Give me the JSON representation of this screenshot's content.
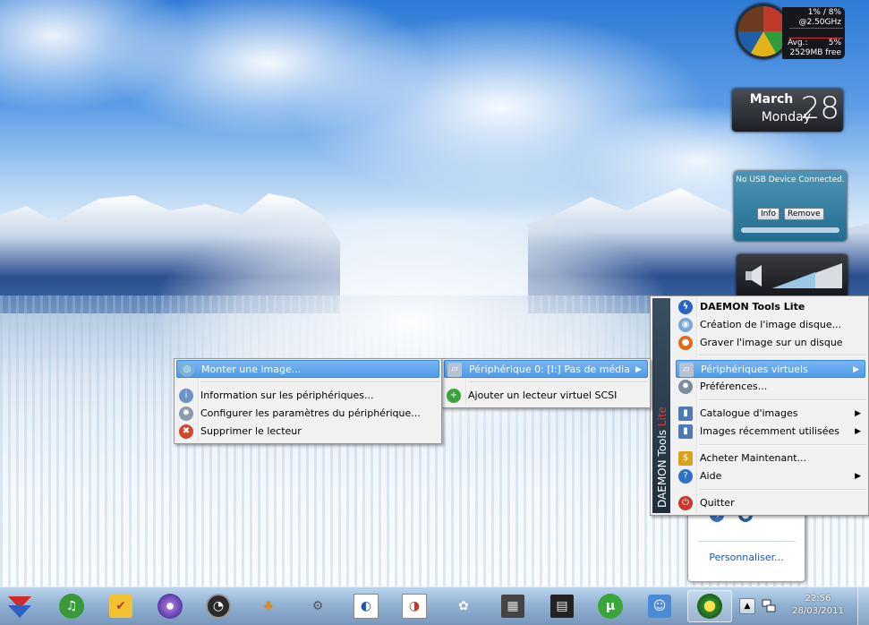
{
  "gadgets": {
    "cpu_meter": {
      "usage_line": "1% /   8%",
      "speed": "@2.50GHz",
      "avg_label": "Avg.:",
      "avg_value": "5%",
      "memory_free": "2529MB free"
    },
    "calendar": {
      "month": "March",
      "weekday": "Monday",
      "day": "28"
    },
    "usb": {
      "message": "No USB Device Connected.",
      "info_label": "Info",
      "remove_label": "Remove"
    },
    "volume": {
      "icon": "speaker-icon"
    }
  },
  "tray_popup": {
    "customize_link": "Personnaliser..."
  },
  "daemon_menu": {
    "banner_text": "DAEMON Tools",
    "banner_accent": "Lite",
    "items": [
      {
        "label": "DAEMON Tools Lite",
        "icon": "daemon-lightning-icon"
      },
      {
        "label": "Création de l'image disque...",
        "icon": "disc-create-icon"
      },
      {
        "label": "Graver l'image sur un disque",
        "icon": "burn-icon"
      },
      {
        "label": "Périphériques virtuels",
        "icon": "virtual-drive-icon"
      },
      {
        "label": "Préférences...",
        "icon": "gear-icon"
      },
      {
        "label": "Catalogue d'images",
        "icon": "catalog-icon"
      },
      {
        "label": "Images récemment utilisées",
        "icon": "recent-images-icon"
      },
      {
        "label": "Acheter Maintenant...",
        "icon": "buy-icon"
      },
      {
        "label": "Aide",
        "icon": "help-icon"
      },
      {
        "label": "Quitter",
        "icon": "power-icon"
      }
    ]
  },
  "devices_menu": {
    "items": [
      {
        "label": "Périphérique 0: [I:] Pas de média",
        "icon": "drive-icon"
      },
      {
        "label": "Ajouter un lecteur virtuel SCSI",
        "icon": "add-drive-icon"
      }
    ]
  },
  "drive_menu": {
    "items": [
      {
        "label": "Monter une image...",
        "icon": "mount-icon"
      },
      {
        "label": "Information sur les périphériques...",
        "icon": "info-icon"
      },
      {
        "label": "Configurer les paramètres du périphérique...",
        "icon": "settings-icon"
      },
      {
        "label": "Supprimer le lecteur",
        "icon": "delete-icon"
      }
    ]
  },
  "taskbar": {
    "apps": [
      {
        "icon": "start-arrow-icon"
      },
      {
        "icon": "music-ex-icon"
      },
      {
        "icon": "checkmark-app-icon"
      },
      {
        "icon": "disc-app-icon"
      },
      {
        "icon": "gauge-app-icon"
      },
      {
        "icon": "pineapple-app-icon"
      },
      {
        "icon": "pipe-app-icon"
      },
      {
        "icon": "player-app-icon-1"
      },
      {
        "icon": "player-app-icon-2"
      },
      {
        "icon": "gnome-foot-icon"
      },
      {
        "icon": "chip-app-icon"
      },
      {
        "icon": "film-app-icon"
      },
      {
        "icon": "utorrent-icon"
      },
      {
        "icon": "finder-face-icon"
      },
      {
        "icon": "daemon-tools-icon"
      }
    ],
    "clock_time": "22:56",
    "clock_date": "28/03/2011"
  },
  "colors": {
    "menu_highlight": "#4e9be8",
    "usb_gadget": "#236d90",
    "taskbar": "#96b4d2",
    "link": "#1a56b5"
  }
}
